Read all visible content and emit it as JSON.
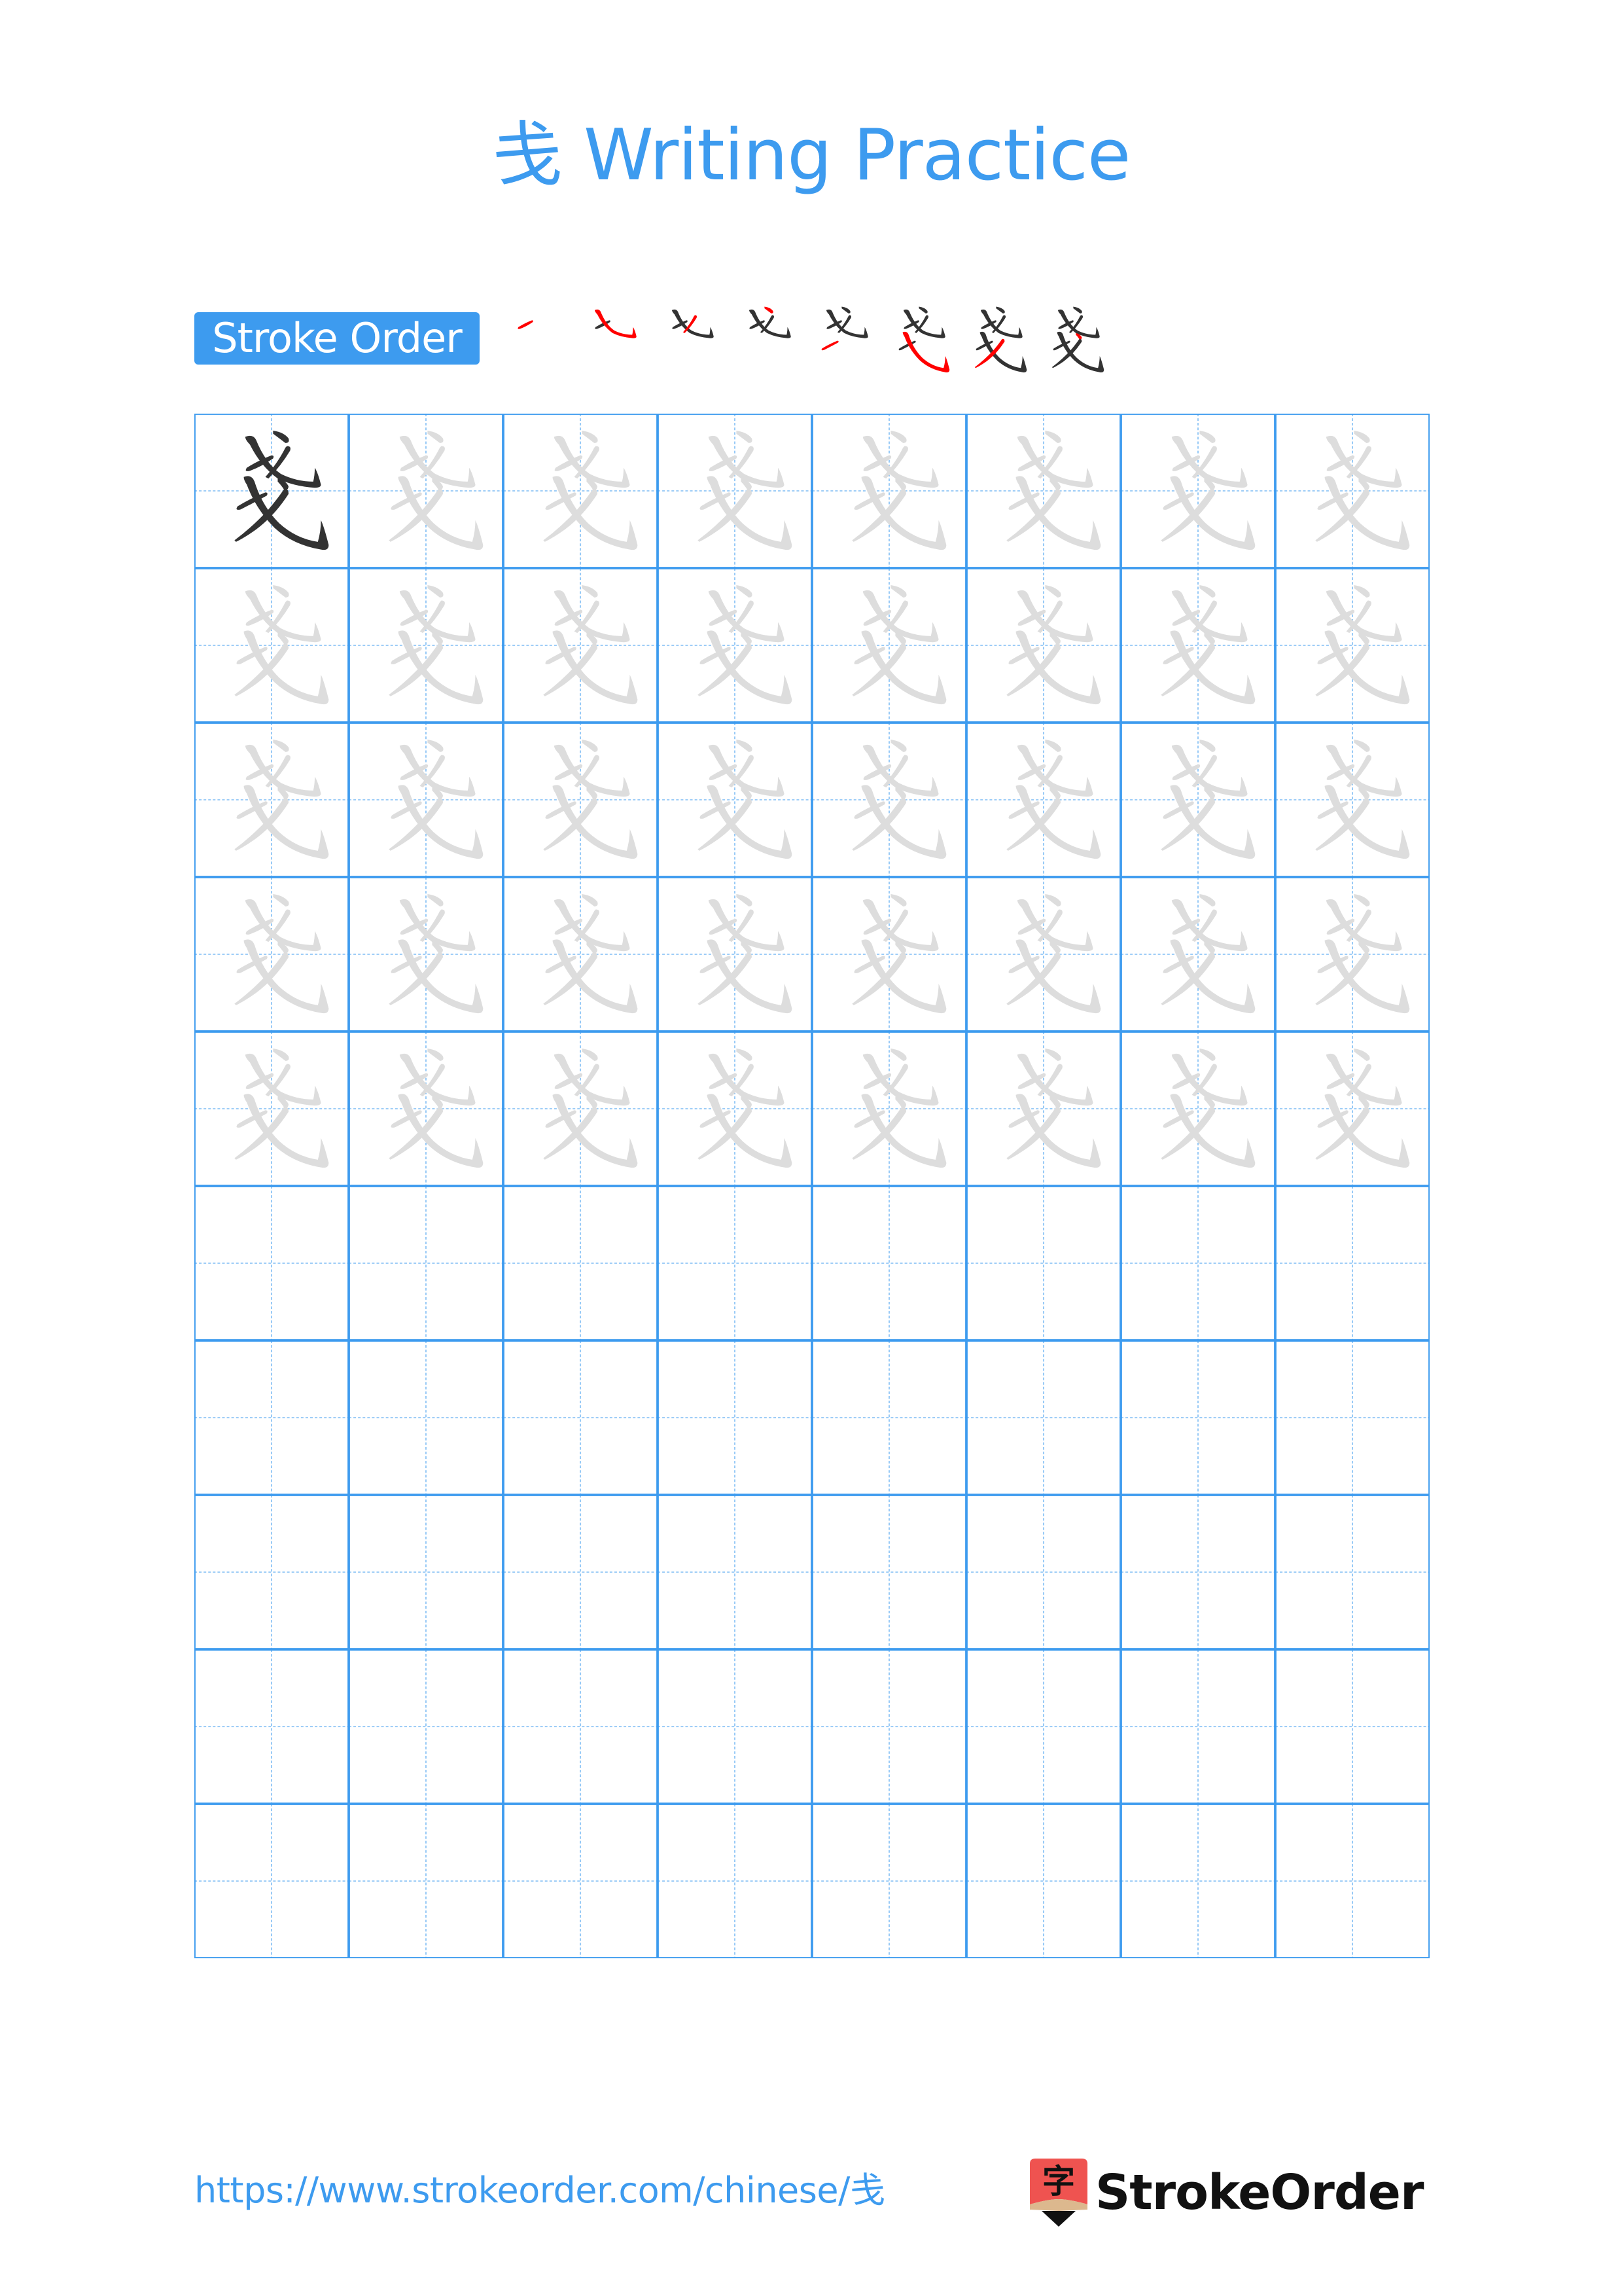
{
  "page": {
    "character": "戋",
    "title_suffix": "Writing Practice",
    "title": "戋 Writing Practice"
  },
  "stroke_order": {
    "label": "Stroke Order",
    "stroke_count": 8,
    "strokes": [
      "rising stroke (top)",
      "slanting hook (top)",
      "left-falling stroke (top)",
      "dot (top)",
      "rising stroke (bottom)",
      "slanting hook (bottom)",
      "left-falling stroke (bottom)",
      "dot (bottom)"
    ],
    "highlight_color": "#ff0000",
    "done_color": "#333333"
  },
  "grid": {
    "columns": 8,
    "rows": 10,
    "model_cells": 1,
    "trace_rows": 5,
    "empty_rows": 5,
    "line_color": "#3d9bef",
    "model_color": "#333333",
    "trace_color": "#dddddd"
  },
  "footer": {
    "url": "https://www.strokeorder.com/chinese/戋",
    "brand": "StrokeOrder",
    "logo_glyph": "字",
    "logo_colors": {
      "body": "#ef5350",
      "band": "#dcb88e",
      "tip": "#111111"
    }
  }
}
